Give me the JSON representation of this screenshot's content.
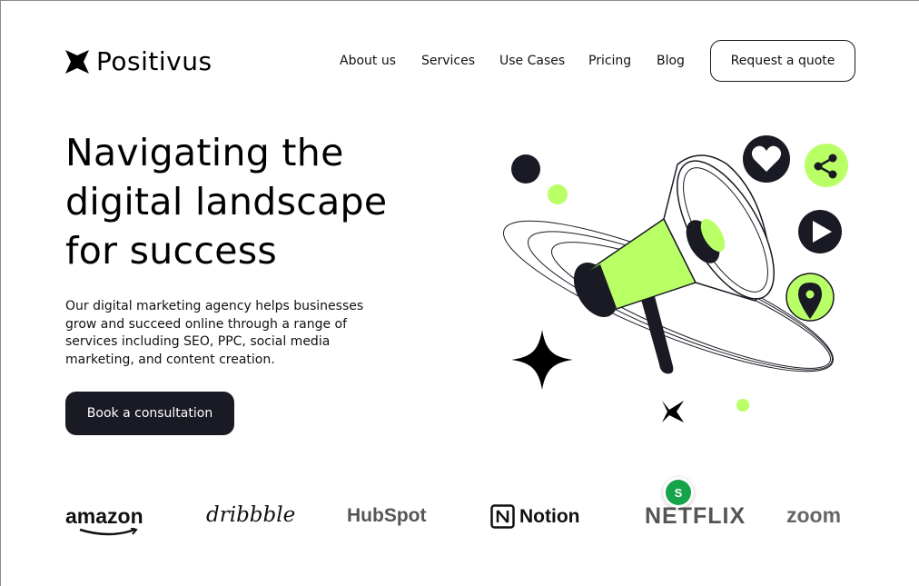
{
  "brand": {
    "name": "Positivus"
  },
  "nav": {
    "links": [
      "About us",
      "Services",
      "Use Cases",
      "Pricing",
      "Blog"
    ],
    "cta_label": "Request a quote"
  },
  "hero": {
    "title_lines": [
      "Navigating the",
      "digital landscape",
      "for success"
    ],
    "description": "Our digital marketing agency helps businesses grow and succeed online through a range of services including SEO, PPC, social media marketing, and content creation.",
    "cta_label": "Book a consultation"
  },
  "colors": {
    "accent": "#b9ff66",
    "dark": "#191a23"
  },
  "illustration": {
    "icons": [
      "megaphone-icon",
      "heart-icon",
      "share-icon",
      "play-icon",
      "location-pin-icon",
      "sparkle-icon"
    ]
  },
  "logos": {
    "amazon": "amazon",
    "dribbble": "dribbble",
    "hubspot": "HubSpot",
    "notion": "Notion",
    "netflix": "NETFLIX",
    "zoom": "zoom"
  },
  "avatar": {
    "initial": "S"
  }
}
